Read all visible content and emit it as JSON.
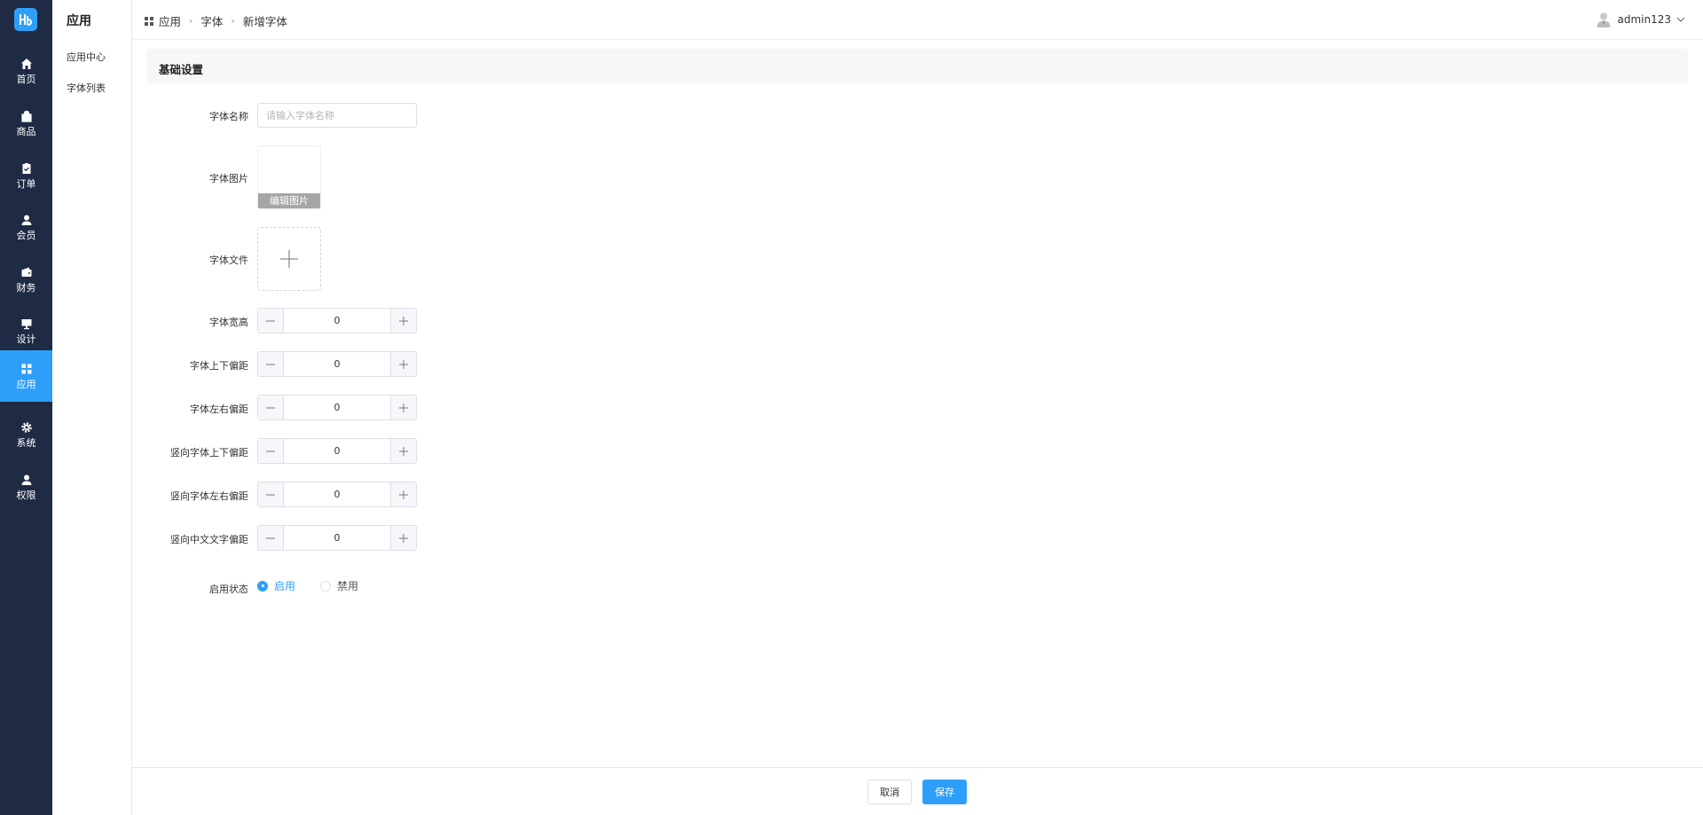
{
  "nav": {
    "items": [
      {
        "label": "首页",
        "icon": "home-icon"
      },
      {
        "label": "商品",
        "icon": "bag-icon"
      },
      {
        "label": "订单",
        "icon": "clipboard-icon"
      },
      {
        "label": "会员",
        "icon": "user-icon"
      },
      {
        "label": "财务",
        "icon": "wallet-icon"
      },
      {
        "label": "设计",
        "icon": "monitor-icon"
      },
      {
        "label": "应用",
        "icon": "grid-icon"
      },
      {
        "label": "系统",
        "icon": "gear-icon"
      },
      {
        "label": "权限",
        "icon": "person-icon"
      }
    ],
    "active": "应用"
  },
  "sidebar": {
    "title": "应用",
    "items": [
      {
        "label": "应用中心"
      },
      {
        "label": "字体列表"
      }
    ]
  },
  "header": {
    "breadcrumb": [
      "应用",
      "字体",
      "新增字体"
    ],
    "username": "admin123"
  },
  "form": {
    "section_title": "基础设置",
    "font_name": {
      "label": "字体名称",
      "value": "",
      "placeholder": "请输入字体名称"
    },
    "font_image": {
      "label": "字体图片",
      "edit_label": "编辑图片"
    },
    "font_file": {
      "label": "字体文件"
    },
    "steppers": [
      {
        "label": "字体宽高",
        "value": "0"
      },
      {
        "label": "字体上下偏距",
        "value": "0"
      },
      {
        "label": "字体左右偏距",
        "value": "0"
      },
      {
        "label": "竖向字体上下偏距",
        "value": "0"
      },
      {
        "label": "竖向字体左右偏距",
        "value": "0"
      },
      {
        "label": "竖向中文文字偏距",
        "value": "0"
      }
    ],
    "status": {
      "label": "启用状态",
      "options": [
        "启用",
        "禁用"
      ],
      "selected": "启用"
    }
  },
  "footer": {
    "cancel_label": "取消",
    "save_label": "保存"
  },
  "colors": {
    "nav_bg": "#1f2a44",
    "accent": "#2e9ff8"
  }
}
